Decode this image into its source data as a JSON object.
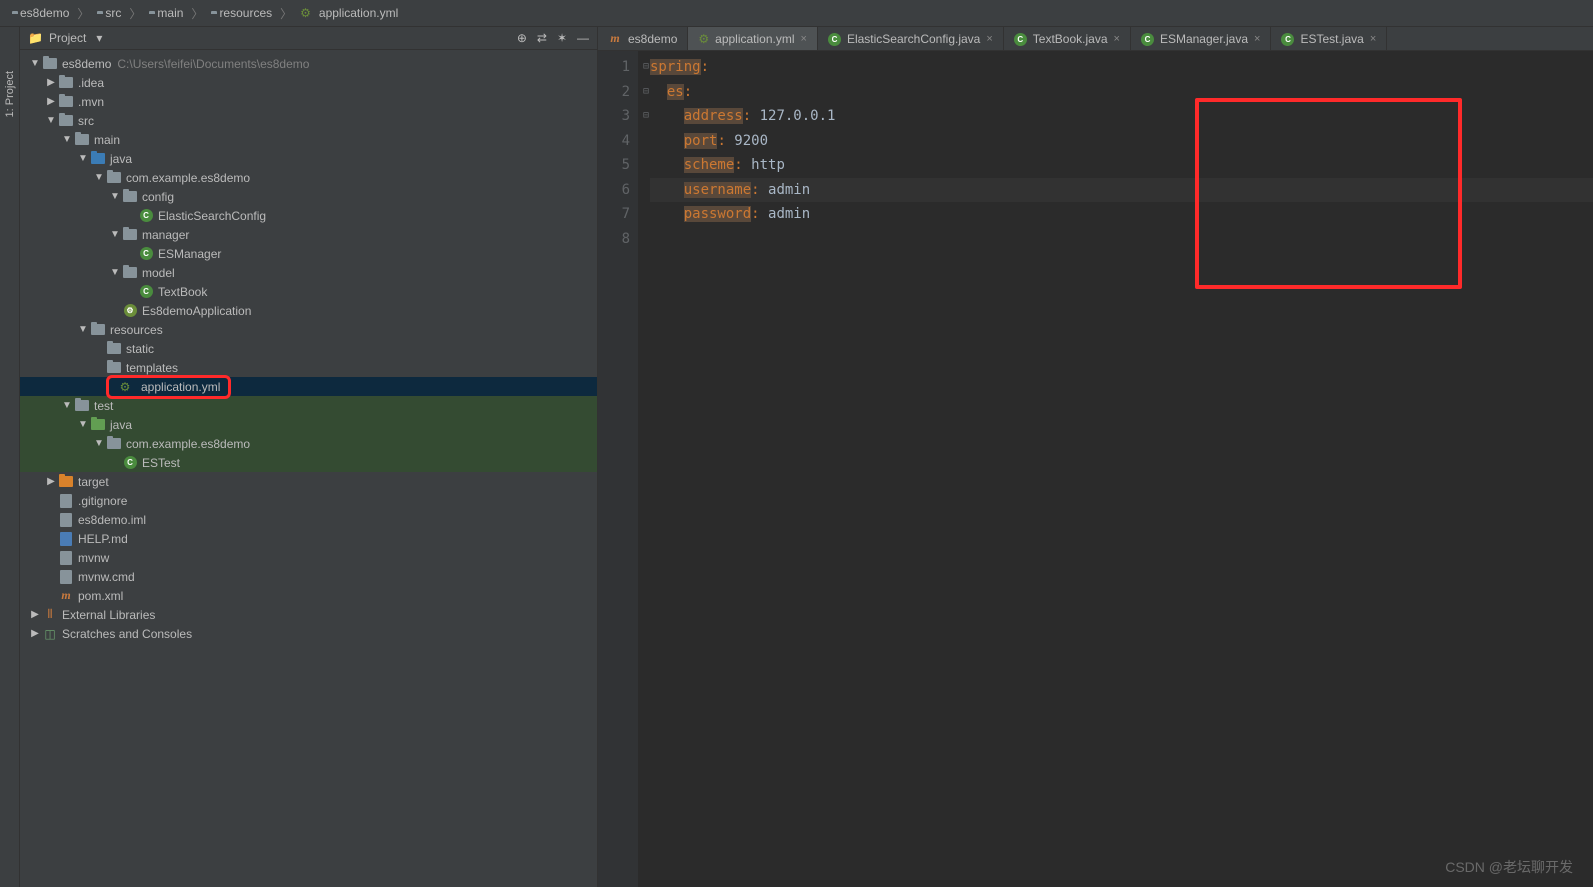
{
  "breadcrumb": [
    "es8demo",
    "src",
    "main",
    "resources",
    "application.yml"
  ],
  "sidetab": "1: Project",
  "panel": {
    "title": "Project",
    "actions": [
      "target-icon",
      "settings-icon",
      "gear-icon",
      "minimize-icon"
    ]
  },
  "tree": [
    {
      "d": 0,
      "exp": "▼",
      "icon": "folder",
      "label": "es8demo",
      "hint": "C:\\Users\\feifei\\Documents\\es8demo"
    },
    {
      "d": 1,
      "exp": "▶",
      "icon": "folder",
      "label": ".idea"
    },
    {
      "d": 1,
      "exp": "▶",
      "icon": "folder",
      "label": ".mvn"
    },
    {
      "d": 1,
      "exp": "▼",
      "icon": "folder",
      "label": "src"
    },
    {
      "d": 2,
      "exp": "▼",
      "icon": "folder",
      "label": "main"
    },
    {
      "d": 3,
      "exp": "▼",
      "icon": "folder-blue",
      "label": "java"
    },
    {
      "d": 4,
      "exp": "▼",
      "icon": "pkg",
      "label": "com.example.es8demo"
    },
    {
      "d": 5,
      "exp": "▼",
      "icon": "pkg",
      "label": "config"
    },
    {
      "d": 6,
      "exp": "",
      "icon": "class",
      "label": "ElasticSearchConfig"
    },
    {
      "d": 5,
      "exp": "▼",
      "icon": "pkg",
      "label": "manager"
    },
    {
      "d": 6,
      "exp": "",
      "icon": "class",
      "label": "ESManager"
    },
    {
      "d": 5,
      "exp": "▼",
      "icon": "pkg",
      "label": "model"
    },
    {
      "d": 6,
      "exp": "",
      "icon": "class",
      "label": "TextBook"
    },
    {
      "d": 5,
      "exp": "",
      "icon": "class-cfg",
      "label": "Es8demoApplication"
    },
    {
      "d": 3,
      "exp": "▼",
      "icon": "folder",
      "label": "resources"
    },
    {
      "d": 4,
      "exp": "",
      "icon": "folder",
      "label": "static"
    },
    {
      "d": 4,
      "exp": "",
      "icon": "folder",
      "label": "templates"
    },
    {
      "d": 4,
      "exp": "",
      "icon": "cfg",
      "label": "application.yml",
      "selected": true,
      "boxed": true
    },
    {
      "d": 2,
      "exp": "▼",
      "icon": "folder",
      "label": "test",
      "test": true
    },
    {
      "d": 3,
      "exp": "▼",
      "icon": "folder-green",
      "label": "java",
      "test": true
    },
    {
      "d": 4,
      "exp": "▼",
      "icon": "pkg",
      "label": "com.example.es8demo",
      "test": true
    },
    {
      "d": 5,
      "exp": "",
      "icon": "class",
      "label": "ESTest",
      "test": true
    },
    {
      "d": 1,
      "exp": "▶",
      "icon": "folder-orange",
      "label": "target"
    },
    {
      "d": 1,
      "exp": "",
      "icon": "file",
      "label": ".gitignore"
    },
    {
      "d": 1,
      "exp": "",
      "icon": "file",
      "label": "es8demo.iml"
    },
    {
      "d": 1,
      "exp": "",
      "icon": "file-md",
      "label": "HELP.md"
    },
    {
      "d": 1,
      "exp": "",
      "icon": "file",
      "label": "mvnw"
    },
    {
      "d": 1,
      "exp": "",
      "icon": "file",
      "label": "mvnw.cmd"
    },
    {
      "d": 1,
      "exp": "",
      "icon": "maven",
      "label": "pom.xml"
    },
    {
      "d": 0,
      "exp": "▶",
      "icon": "lib",
      "label": "External Libraries"
    },
    {
      "d": 0,
      "exp": "▶",
      "icon": "scratch",
      "label": "Scratches and Consoles"
    }
  ],
  "tabs": [
    {
      "icon": "maven",
      "label": "es8demo",
      "active": false,
      "close": false
    },
    {
      "icon": "cfg",
      "label": "application.yml",
      "active": true,
      "close": true
    },
    {
      "icon": "class",
      "label": "ElasticSearchConfig.java",
      "active": false,
      "close": true
    },
    {
      "icon": "class",
      "label": "TextBook.java",
      "active": false,
      "close": true
    },
    {
      "icon": "class",
      "label": "ESManager.java",
      "active": false,
      "close": true
    },
    {
      "icon": "class",
      "label": "ESTest.java",
      "active": false,
      "close": true
    }
  ],
  "code": {
    "lines": [
      [
        {
          "t": "spring",
          "c": "hl-yellow"
        },
        {
          "t": ":",
          "c": "hl-orange"
        }
      ],
      [
        {
          "t": "  "
        },
        {
          "t": "es",
          "c": "hl-yellow"
        },
        {
          "t": ":",
          "c": "hl-orange"
        }
      ],
      [
        {
          "t": "    "
        },
        {
          "t": "address",
          "c": "hl-yellow"
        },
        {
          "t": ": ",
          "c": "hl-orange"
        },
        {
          "t": "127.0.0.1",
          "c": "hl-val"
        }
      ],
      [
        {
          "t": "    "
        },
        {
          "t": "port",
          "c": "hl-yellow"
        },
        {
          "t": ": ",
          "c": "hl-orange"
        },
        {
          "t": "9200",
          "c": "hl-val"
        }
      ],
      [
        {
          "t": "    "
        },
        {
          "t": "scheme",
          "c": "hl-yellow"
        },
        {
          "t": ": ",
          "c": "hl-orange"
        },
        {
          "t": "http",
          "c": "hl-val"
        }
      ],
      [
        {
          "t": "    "
        },
        {
          "t": "username",
          "c": "hl-yellow"
        },
        {
          "t": ": ",
          "c": "hl-orange"
        },
        {
          "t": "admin",
          "c": "hl-val"
        }
      ],
      [
        {
          "t": "    "
        },
        {
          "t": "password",
          "c": "hl-yellow"
        },
        {
          "t": ": ",
          "c": "hl-orange"
        },
        {
          "t": "admin",
          "c": "hl-val"
        }
      ],
      []
    ],
    "current_line": 6
  },
  "watermark": "CSDN @老坛聊开发"
}
